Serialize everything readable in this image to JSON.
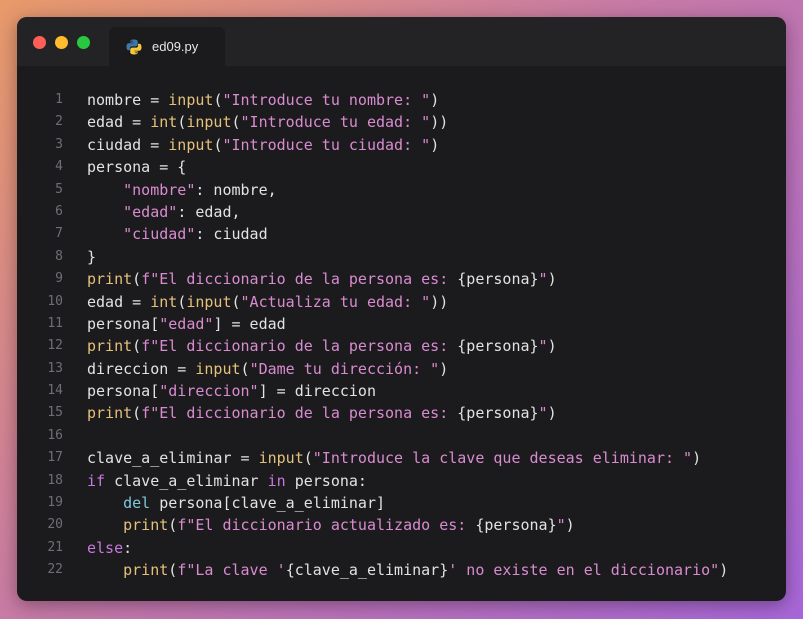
{
  "window": {
    "tab": {
      "filename": "ed09.py",
      "icon": "python-icon"
    },
    "traffic_lights": {
      "close": "#ff5f57",
      "minimize": "#febc2e",
      "maximize": "#28c840"
    }
  },
  "colors": {
    "background": "#1b1b1d",
    "keyword": "#c678dd",
    "function": "#e5c07b",
    "string": "#d98bd0",
    "plain": "#e2e2e2"
  },
  "code": {
    "language": "python",
    "lines": [
      {
        "n": "1",
        "tokens": [
          {
            "t": "nombre = ",
            "c": "plain"
          },
          {
            "t": "input",
            "c": "fn"
          },
          {
            "t": "(",
            "c": "plain"
          },
          {
            "t": "\"Introduce tu nombre: \"",
            "c": "str"
          },
          {
            "t": ")",
            "c": "plain"
          }
        ]
      },
      {
        "n": "2",
        "tokens": [
          {
            "t": "edad = ",
            "c": "plain"
          },
          {
            "t": "int",
            "c": "fn"
          },
          {
            "t": "(",
            "c": "plain"
          },
          {
            "t": "input",
            "c": "fn"
          },
          {
            "t": "(",
            "c": "plain"
          },
          {
            "t": "\"Introduce tu edad: \"",
            "c": "str"
          },
          {
            "t": "))",
            "c": "plain"
          }
        ]
      },
      {
        "n": "3",
        "tokens": [
          {
            "t": "ciudad = ",
            "c": "plain"
          },
          {
            "t": "input",
            "c": "fn"
          },
          {
            "t": "(",
            "c": "plain"
          },
          {
            "t": "\"Introduce tu ciudad: \"",
            "c": "str"
          },
          {
            "t": ")",
            "c": "plain"
          }
        ]
      },
      {
        "n": "4",
        "tokens": [
          {
            "t": "persona = {",
            "c": "plain"
          }
        ]
      },
      {
        "n": "5",
        "tokens": [
          {
            "t": "    ",
            "c": "plain"
          },
          {
            "t": "\"nombre\"",
            "c": "str"
          },
          {
            "t": ": nombre,",
            "c": "plain"
          }
        ]
      },
      {
        "n": "6",
        "tokens": [
          {
            "t": "    ",
            "c": "plain"
          },
          {
            "t": "\"edad\"",
            "c": "str"
          },
          {
            "t": ": edad,",
            "c": "plain"
          }
        ]
      },
      {
        "n": "7",
        "tokens": [
          {
            "t": "    ",
            "c": "plain"
          },
          {
            "t": "\"ciudad\"",
            "c": "str"
          },
          {
            "t": ": ciudad",
            "c": "plain"
          }
        ]
      },
      {
        "n": "8",
        "tokens": [
          {
            "t": "}",
            "c": "plain"
          }
        ]
      },
      {
        "n": "9",
        "tokens": [
          {
            "t": "print",
            "c": "fn"
          },
          {
            "t": "(",
            "c": "plain"
          },
          {
            "t": "f\"El diccionario de la persona es: ",
            "c": "str"
          },
          {
            "t": "{persona}",
            "c": "plain"
          },
          {
            "t": "\"",
            "c": "str"
          },
          {
            "t": ")",
            "c": "plain"
          }
        ]
      },
      {
        "n": "10",
        "tokens": [
          {
            "t": "edad = ",
            "c": "plain"
          },
          {
            "t": "int",
            "c": "fn"
          },
          {
            "t": "(",
            "c": "plain"
          },
          {
            "t": "input",
            "c": "fn"
          },
          {
            "t": "(",
            "c": "plain"
          },
          {
            "t": "\"Actualiza tu edad: \"",
            "c": "str"
          },
          {
            "t": "))",
            "c": "plain"
          }
        ]
      },
      {
        "n": "11",
        "tokens": [
          {
            "t": "persona[",
            "c": "plain"
          },
          {
            "t": "\"edad\"",
            "c": "str"
          },
          {
            "t": "] = edad",
            "c": "plain"
          }
        ]
      },
      {
        "n": "12",
        "tokens": [
          {
            "t": "print",
            "c": "fn"
          },
          {
            "t": "(",
            "c": "plain"
          },
          {
            "t": "f\"El diccionario de la persona es: ",
            "c": "str"
          },
          {
            "t": "{persona}",
            "c": "plain"
          },
          {
            "t": "\"",
            "c": "str"
          },
          {
            "t": ")",
            "c": "plain"
          }
        ]
      },
      {
        "n": "13",
        "tokens": [
          {
            "t": "direccion = ",
            "c": "plain"
          },
          {
            "t": "input",
            "c": "fn"
          },
          {
            "t": "(",
            "c": "plain"
          },
          {
            "t": "\"Dame tu dirección: \"",
            "c": "str"
          },
          {
            "t": ")",
            "c": "plain"
          }
        ]
      },
      {
        "n": "14",
        "tokens": [
          {
            "t": "persona[",
            "c": "plain"
          },
          {
            "t": "\"direccion\"",
            "c": "str"
          },
          {
            "t": "] = direccion",
            "c": "plain"
          }
        ]
      },
      {
        "n": "15",
        "tokens": [
          {
            "t": "print",
            "c": "fn"
          },
          {
            "t": "(",
            "c": "plain"
          },
          {
            "t": "f\"El diccionario de la persona es: ",
            "c": "str"
          },
          {
            "t": "{persona}",
            "c": "plain"
          },
          {
            "t": "\"",
            "c": "str"
          },
          {
            "t": ")",
            "c": "plain"
          }
        ]
      },
      {
        "n": "16",
        "tokens": []
      },
      {
        "n": "17",
        "tokens": [
          {
            "t": "clave_a_eliminar = ",
            "c": "plain"
          },
          {
            "t": "input",
            "c": "fn"
          },
          {
            "t": "(",
            "c": "plain"
          },
          {
            "t": "\"Introduce la clave que deseas eliminar: \"",
            "c": "str"
          },
          {
            "t": ")",
            "c": "plain"
          }
        ]
      },
      {
        "n": "18",
        "tokens": [
          {
            "t": "if",
            "c": "kw"
          },
          {
            "t": " clave_a_eliminar ",
            "c": "plain"
          },
          {
            "t": "in",
            "c": "kw"
          },
          {
            "t": " persona:",
            "c": "plain"
          }
        ]
      },
      {
        "n": "19",
        "tokens": [
          {
            "t": "    ",
            "c": "plain"
          },
          {
            "t": "del",
            "c": "imp"
          },
          {
            "t": " persona[clave_a_eliminar]",
            "c": "plain"
          }
        ]
      },
      {
        "n": "20",
        "tokens": [
          {
            "t": "    ",
            "c": "plain"
          },
          {
            "t": "print",
            "c": "fn"
          },
          {
            "t": "(",
            "c": "plain"
          },
          {
            "t": "f\"El diccionario actualizado es: ",
            "c": "str"
          },
          {
            "t": "{persona}",
            "c": "plain"
          },
          {
            "t": "\"",
            "c": "str"
          },
          {
            "t": ")",
            "c": "plain"
          }
        ]
      },
      {
        "n": "21",
        "tokens": [
          {
            "t": "else",
            "c": "kw"
          },
          {
            "t": ":",
            "c": "plain"
          }
        ]
      },
      {
        "n": "22",
        "tokens": [
          {
            "t": "    ",
            "c": "plain"
          },
          {
            "t": "print",
            "c": "fn"
          },
          {
            "t": "(",
            "c": "plain"
          },
          {
            "t": "f\"La clave '",
            "c": "str"
          },
          {
            "t": "{clave_a_eliminar}",
            "c": "plain"
          },
          {
            "t": "' no existe en el diccionario\"",
            "c": "str"
          },
          {
            "t": ")",
            "c": "plain"
          }
        ]
      }
    ]
  }
}
